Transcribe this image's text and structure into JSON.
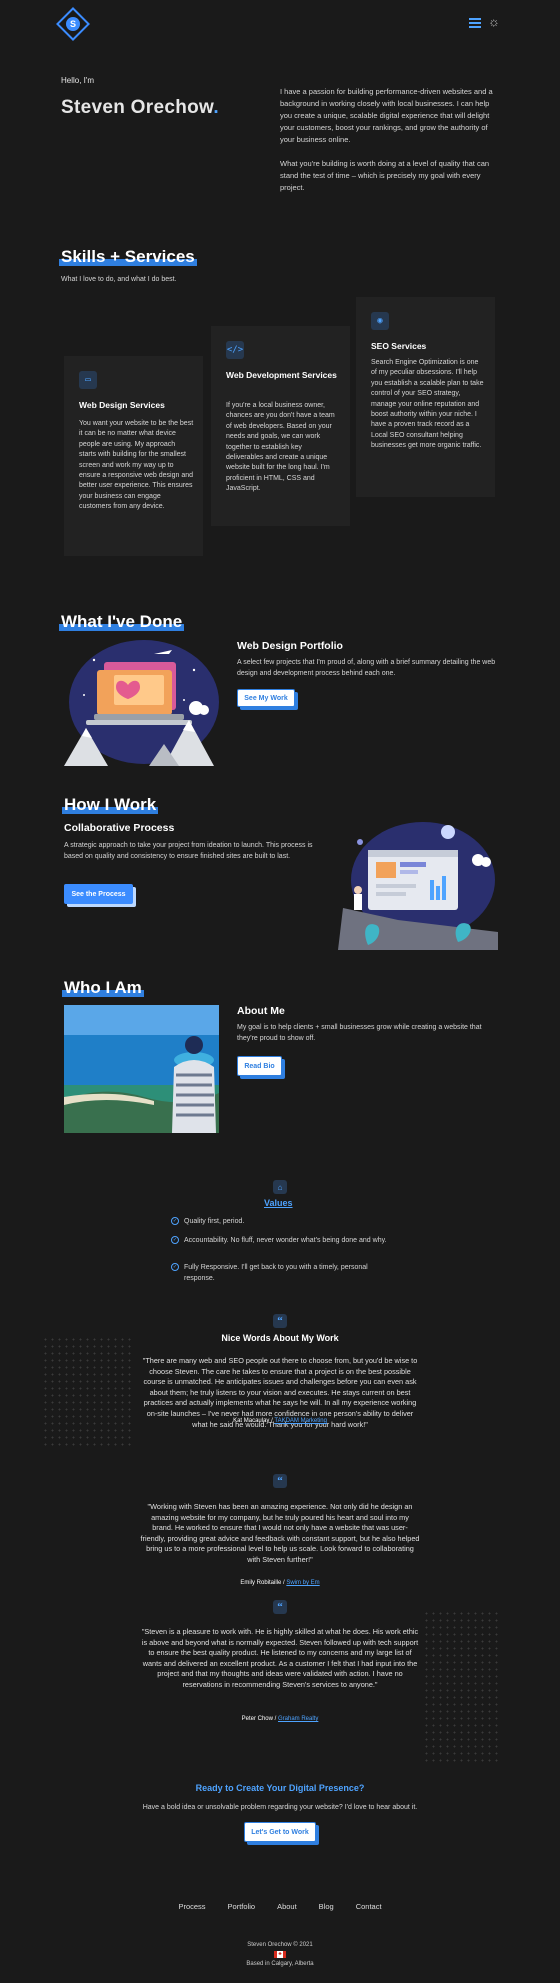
{
  "header": {
    "logo_letter": "S",
    "menu_icon": "hamburger-icon",
    "theme_icon": "sun-icon"
  },
  "hero": {
    "greeting": "Hello, I'm",
    "name": "Steven Orechow",
    "name_dot": ".",
    "intro_1": "I have a passion for building performance-driven websites and a background in working closely with local businesses. I can help you create a unique, scalable digital experience that will delight your customers, boost your rankings, and grow the authority of your business online.",
    "intro_2": "What you're building is worth doing at a level of quality that can stand the test of time – which is precisely my goal with every project."
  },
  "skills": {
    "heading": "Skills + Services",
    "subheading": "What I love to do, and what I do best.",
    "cards": [
      {
        "icon": "laptop-icon",
        "title": "Web Design Services",
        "text": "You want your website to be the best it can be no matter what device people are using. My approach starts with building for the smallest screen and work my way up to ensure a responsive web design and better user experience. This ensures your business can engage customers from any device."
      },
      {
        "icon": "code-icon",
        "title": "Web Development Services",
        "text": "If you're a local business owner, chances are you don't have a team of web developers. Based on your needs and goals, we can work together to establish key deliverables and create a unique website built for the long haul. I'm proficient in HTML, CSS and JavaScript."
      },
      {
        "icon": "seo-icon",
        "title": "SEO Services",
        "text": "Search Engine Optimization is one of my peculiar obsessions. I'll help you establish a scalable plan to take control of your SEO strategy, manage your online reputation and boost authority within your niche. I have a proven track record as a Local SEO consultant helping businesses get more organic traffic."
      }
    ]
  },
  "done": {
    "heading": "What I've Done",
    "title": "Web Design Portfolio",
    "text": "A select few projects that I'm proud of, along with a brief summary detailing the web design and development process behind each one.",
    "button": "See My Work"
  },
  "how": {
    "heading": "How I Work",
    "title": "Collaborative Process",
    "text": "A strategic approach to take your project from ideation to launch. This process is based on quality and consistency to ensure finished sites are built to last.",
    "button": "See the Process"
  },
  "who": {
    "heading": "Who I Am",
    "title": "About Me",
    "text": "My goal is to help clients + small businesses grow while creating a website that they're proud to show off.",
    "button": "Read Bio"
  },
  "values": {
    "heading": "Values",
    "items": [
      "Quality first, period.",
      "Accountability. No fluff, never wonder what's being done and why.",
      "Fully Responsive. I'll get back to you with a timely, personal response."
    ]
  },
  "testimonials": {
    "heading": "Nice Words About My Work",
    "items": [
      {
        "quote": "\"There are many web and SEO people out there to choose from, but you'd be wise to choose Steven. The care he takes to ensure that a project is on the best possible course is unmatched. He anticipates issues and challenges before you can even ask about them; he truly listens to your vision and executes. He stays current on best practices and actually implements what he says he will. In all my experience working on-site launches – I've never had more confidence in one person's ability to deliver what he said he would. Thank you for your hard work!\"",
        "name": "Kat Macaulay",
        "sep": "/",
        "company": "TAKDAM Marketing"
      },
      {
        "quote": "\"Working with Steven has been an amazing experience. Not only did he design an amazing website for my company, but he truly poured his heart and soul into my brand. He worked to ensure that I would not only have a website that was user-friendly, providing great advice and feedback with constant support, but he also helped bring us to a more professional level to help us scale. Look forward to collaborating with Steven further!\"",
        "name": "Emily Robitaille",
        "sep": "/",
        "company": "Swim by Em"
      },
      {
        "quote": "\"Steven is a pleasure to work with. He is highly skilled at what he does. His work ethic is above and beyond what is normally expected. Steven followed up with tech support to ensure the best quality product. He listened to my concerns and my large list of wants and delivered an excellent product. As a customer I felt that I had input into the project and that my thoughts and ideas were validated with action. I have no reservations in recommending Steven's services to anyone.\"",
        "name": "Peter Chow",
        "sep": "/",
        "company": "Graham Realty"
      }
    ]
  },
  "cta": {
    "heading": "Ready to Create Your Digital Presence?",
    "text": "Have a bold idea or unsolvable problem regarding your website? I'd love to hear about it.",
    "button": "Let's Get to Work"
  },
  "footer": {
    "links": [
      "Process",
      "Portfolio",
      "About",
      "Blog",
      "Contact"
    ],
    "copyright": "Steven Orechow © 2021",
    "location": "Based in Calgary, Alberta",
    "flag_icon": "canada-flag-icon"
  },
  "colors": {
    "accent": "#3b8cff",
    "background": "#1a1a1a",
    "card": "#222222"
  }
}
